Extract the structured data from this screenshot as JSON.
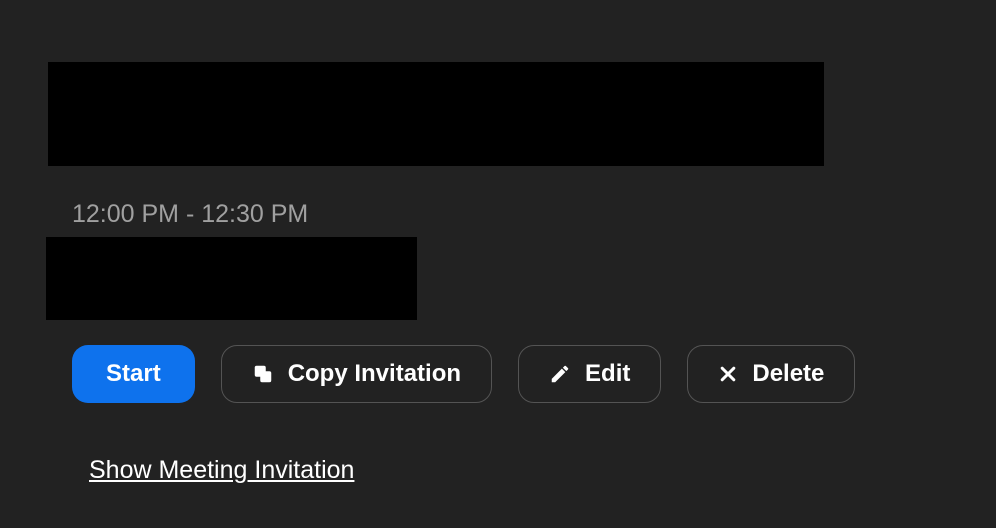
{
  "meeting": {
    "time_range": "12:00 PM - 12:30 PM"
  },
  "buttons": {
    "start_label": "Start",
    "copy_label": "Copy Invitation",
    "edit_label": "Edit",
    "delete_label": "Delete"
  },
  "link": {
    "show_invitation_label": "Show Meeting Invitation"
  }
}
